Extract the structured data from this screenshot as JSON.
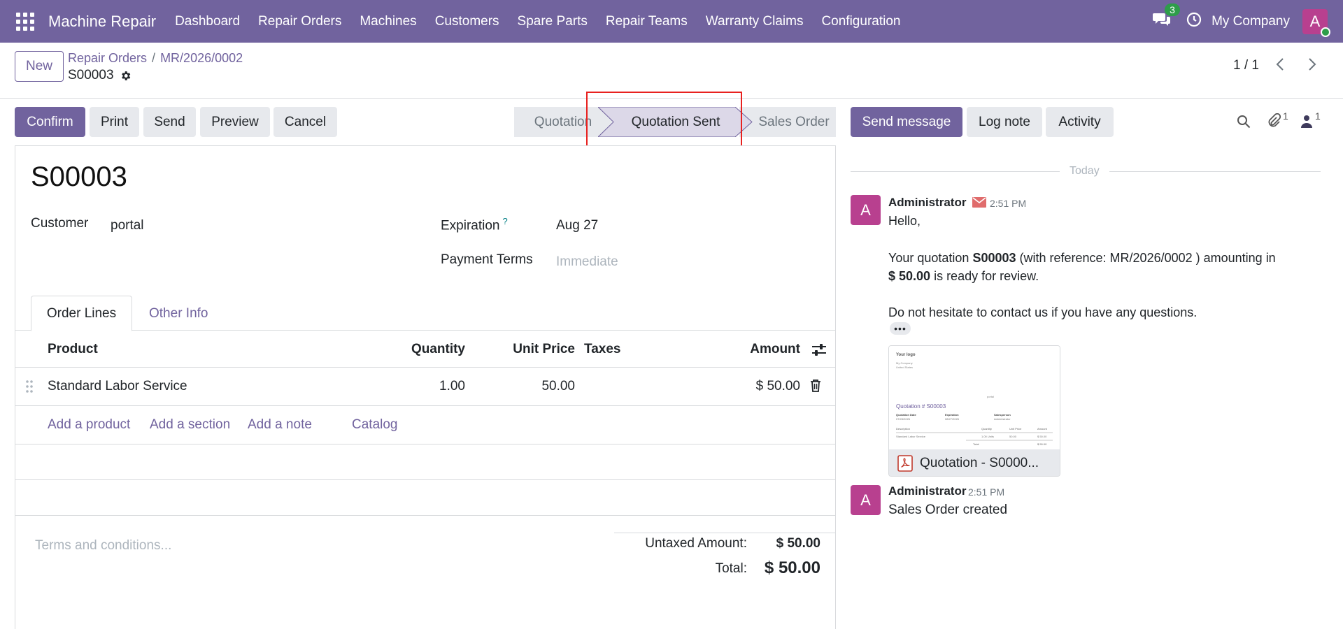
{
  "app": {
    "title": "Machine Repair",
    "company": "My Company",
    "avatar_letter": "A",
    "messages_count": "3"
  },
  "menu": [
    "Dashboard",
    "Repair Orders",
    "Machines",
    "Customers",
    "Spare Parts",
    "Repair Teams",
    "Warranty Claims",
    "Configuration"
  ],
  "control": {
    "new_label": "New",
    "breadcrumb": [
      "Repair Orders",
      "MR/2026/0002"
    ],
    "record_name": "S00003",
    "pager": "1 / 1"
  },
  "actions": {
    "confirm": "Confirm",
    "print": "Print",
    "send": "Send",
    "preview": "Preview",
    "cancel": "Cancel"
  },
  "status": {
    "stages": [
      "Quotation",
      "Quotation Sent",
      "Sales Order"
    ],
    "current": "Quotation Sent"
  },
  "form": {
    "title": "S00003",
    "customer_label": "Customer",
    "customer_value": "portal",
    "expiration_label": "Expiration",
    "expiration_help": "?",
    "expiration_value": "Aug 27",
    "payment_label": "Payment Terms",
    "payment_placeholder": "Immediate",
    "tabs": [
      "Order Lines",
      "Other Info"
    ],
    "columns": {
      "product": "Product",
      "quantity": "Quantity",
      "unit_price": "Unit Price",
      "taxes": "Taxes",
      "amount": "Amount"
    },
    "lines": [
      {
        "product": "Standard Labor Service",
        "quantity": "1.00",
        "unit_price": "50.00",
        "taxes": "",
        "amount": "$ 50.00"
      }
    ],
    "add_links": [
      "Add a product",
      "Add a section",
      "Add a note",
      "Catalog"
    ],
    "terms_placeholder": "Terms and conditions...",
    "untaxed_label": "Untaxed Amount:",
    "untaxed_value": "$ 50.00",
    "total_label": "Total:",
    "total_value": "$ 50.00"
  },
  "chatter": {
    "send_message": "Send message",
    "log_note": "Log note",
    "activity": "Activity",
    "attachments_count": "1",
    "followers_count": "1",
    "today": "Today",
    "messages": [
      {
        "avatar": "A",
        "author": "Administrator",
        "time": "2:51 PM",
        "greeting": "Hello,",
        "line1_pre": "Your quotation ",
        "line1_bold": "S00003",
        "line1_post": " (with reference: MR/2026/0002 ) amounting in",
        "line2_bold": "$ 50.00",
        "line2_post": " is ready for review.",
        "line3": "Do not hesitate to contact us if you have any questions.",
        "more": "•••",
        "attachment": "Quotation - S0000...",
        "thumb": {
          "logo": "Your logo",
          "company": "My Company",
          "country": "United States",
          "partner": "portal",
          "heading": "Quotation # S00003",
          "labels": [
            "Quotation Date",
            "Expiration",
            "Salesperson"
          ],
          "values": [
            "07/28/2026",
            "08/27/2026",
            "Administrator"
          ],
          "cols": [
            "Description",
            "Quantity",
            "Unit Price",
            "Amount"
          ],
          "row": [
            "Standard Labor Service",
            "1.00 Units",
            "50.00",
            "$ 50.00"
          ],
          "total_label": "Total",
          "total_value": "$ 50.00"
        }
      },
      {
        "avatar": "A",
        "author": "Administrator",
        "time": "2:51 PM",
        "body": "Sales Order created"
      }
    ]
  },
  "colors": {
    "brand": "#71639e",
    "avatar": "#b8408f",
    "online": "#2e9d4a",
    "highlight": "#e8211f"
  }
}
